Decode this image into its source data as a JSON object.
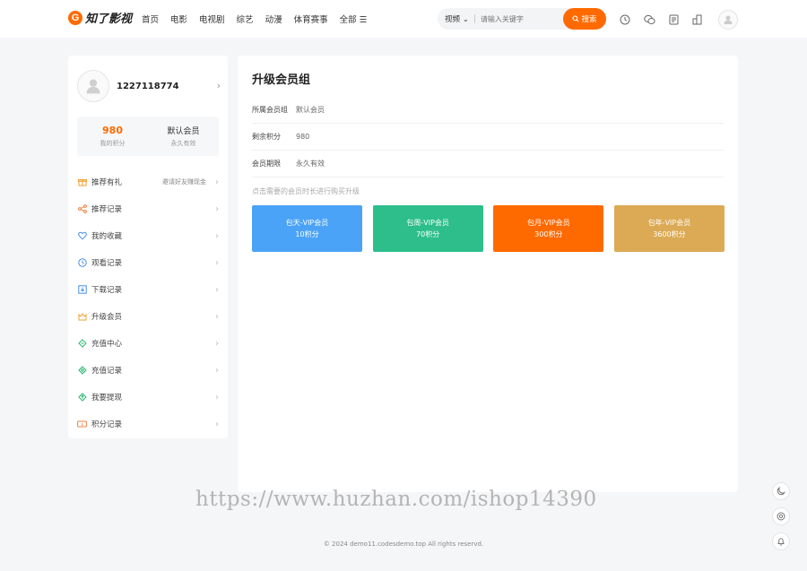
{
  "header": {
    "logo_mark": "G",
    "logo_text": "知了影视",
    "nav": [
      "首页",
      "电影",
      "电视剧",
      "综艺",
      "动漫",
      "体育赛事",
      "全部 ☰"
    ],
    "search": {
      "type_label": "视频",
      "placeholder": "请输入关键字",
      "button_label": "搜索"
    },
    "icons": [
      "clock-icon",
      "wechat-icon",
      "document-icon",
      "building-icon",
      "user-avatar-icon"
    ]
  },
  "sidebar": {
    "username": "1227118774",
    "points_value": "980",
    "points_label": "我的积分",
    "group_value": "默认会员",
    "group_label": "永久有效",
    "menu": [
      {
        "label": "推荐有礼",
        "extra": "邀请好友赚现金",
        "icon": "gift-icon",
        "color": "#f0a030"
      },
      {
        "label": "推荐记录",
        "extra": "",
        "icon": "share-icon",
        "color": "#f08040"
      },
      {
        "label": "我的收藏",
        "extra": "",
        "icon": "heart-icon",
        "color": "#4a90e2"
      },
      {
        "label": "观看记录",
        "extra": "",
        "icon": "history-clock-icon",
        "color": "#4a90e2"
      },
      {
        "label": "下载记录",
        "extra": "",
        "icon": "download-icon",
        "color": "#4a90e2"
      },
      {
        "label": "升级会员",
        "extra": "",
        "icon": "crown-icon",
        "color": "#f0a030"
      },
      {
        "label": "充值中心",
        "extra": "",
        "icon": "ticket-icon",
        "color": "#2bb673"
      },
      {
        "label": "充值记录",
        "extra": "",
        "icon": "ticket-record-icon",
        "color": "#2bb673"
      },
      {
        "label": "我要提现",
        "extra": "",
        "icon": "withdraw-icon",
        "color": "#2bb673"
      },
      {
        "label": "积分记录",
        "extra": "",
        "icon": "points-record-icon",
        "color": "#f08040"
      }
    ]
  },
  "main": {
    "title": "升级会员组",
    "rows": [
      {
        "label": "所属会员组",
        "value": "默认会员"
      },
      {
        "label": "剩余积分",
        "value": "980"
      },
      {
        "label": "会员期限",
        "value": "永久有效"
      }
    ],
    "hint": "点击需要的会员时长进行购买升级",
    "plans": [
      {
        "name": "包天-VIP会员",
        "price": "10积分",
        "color": "#4aa3f7"
      },
      {
        "name": "包周-VIP会员",
        "price": "70积分",
        "color": "#2dbe8b"
      },
      {
        "name": "包月-VIP会员",
        "price": "300积分",
        "color": "#ff6a00"
      },
      {
        "name": "包年-VIP会员",
        "price": "3600积分",
        "color": "#dcaa55"
      }
    ]
  },
  "watermark": "https://www.huzhan.com/ishop14390",
  "footer": "© 2024 demo11.codesdemo.top All rights reservd.",
  "colors": {
    "accent": "#ff6a00",
    "background": "#f5f6f8"
  }
}
